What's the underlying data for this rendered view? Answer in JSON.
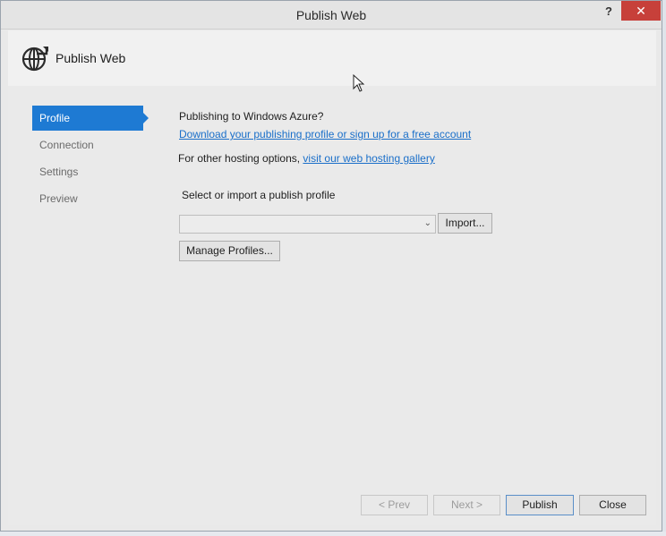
{
  "window": {
    "title": "Publish Web",
    "help_label": "?",
    "close_label": "✕"
  },
  "header": {
    "title": "Publish Web",
    "icon": "globe-arrow-icon"
  },
  "nav": {
    "items": [
      {
        "label": "Profile",
        "active": true
      },
      {
        "label": "Connection",
        "active": false
      },
      {
        "label": "Settings",
        "active": false
      },
      {
        "label": "Preview",
        "active": false
      }
    ]
  },
  "main": {
    "azure_prompt": "Publishing to Windows Azure?",
    "azure_link": "Download your publishing profile or sign up for a free account",
    "hosting_prefix": "For other hosting options,",
    "hosting_link": "visit our web hosting gallery",
    "select_label": "Select or import a publish profile",
    "profile_value": "",
    "import_label": "Import...",
    "manage_label": "Manage Profiles..."
  },
  "footer": {
    "prev_label": "< Prev",
    "next_label": "Next >",
    "publish_label": "Publish",
    "close_label": "Close"
  },
  "colors": {
    "accent": "#1e7ad3",
    "link": "#1a6fc9",
    "close_button": "#c7403a"
  }
}
